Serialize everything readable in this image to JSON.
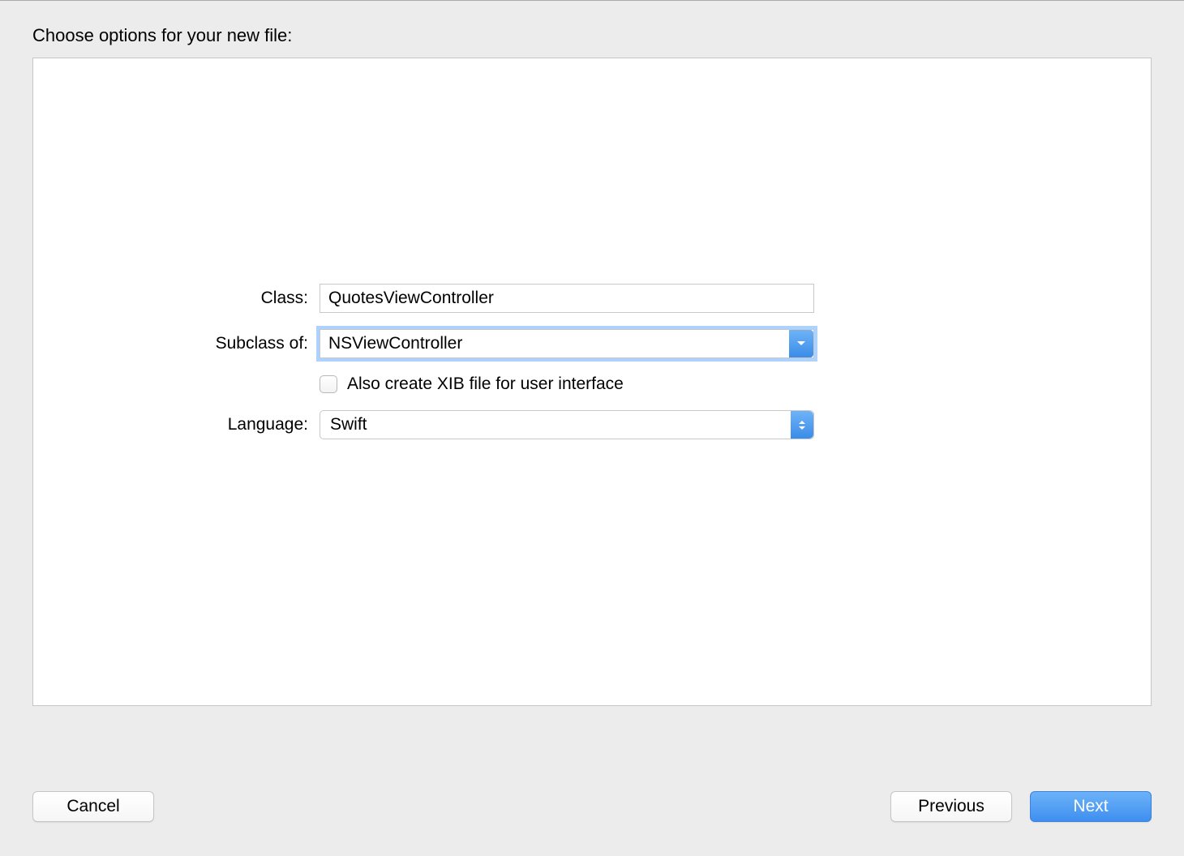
{
  "dialog": {
    "title": "Choose options for your new file:"
  },
  "form": {
    "class_label": "Class:",
    "class_value": "QuotesViewController",
    "subclass_label": "Subclass of:",
    "subclass_value": "NSViewController",
    "xib_checkbox_label": "Also create XIB file for user interface",
    "language_label": "Language:",
    "language_value": "Swift"
  },
  "buttons": {
    "cancel": "Cancel",
    "previous": "Previous",
    "next": "Next"
  }
}
